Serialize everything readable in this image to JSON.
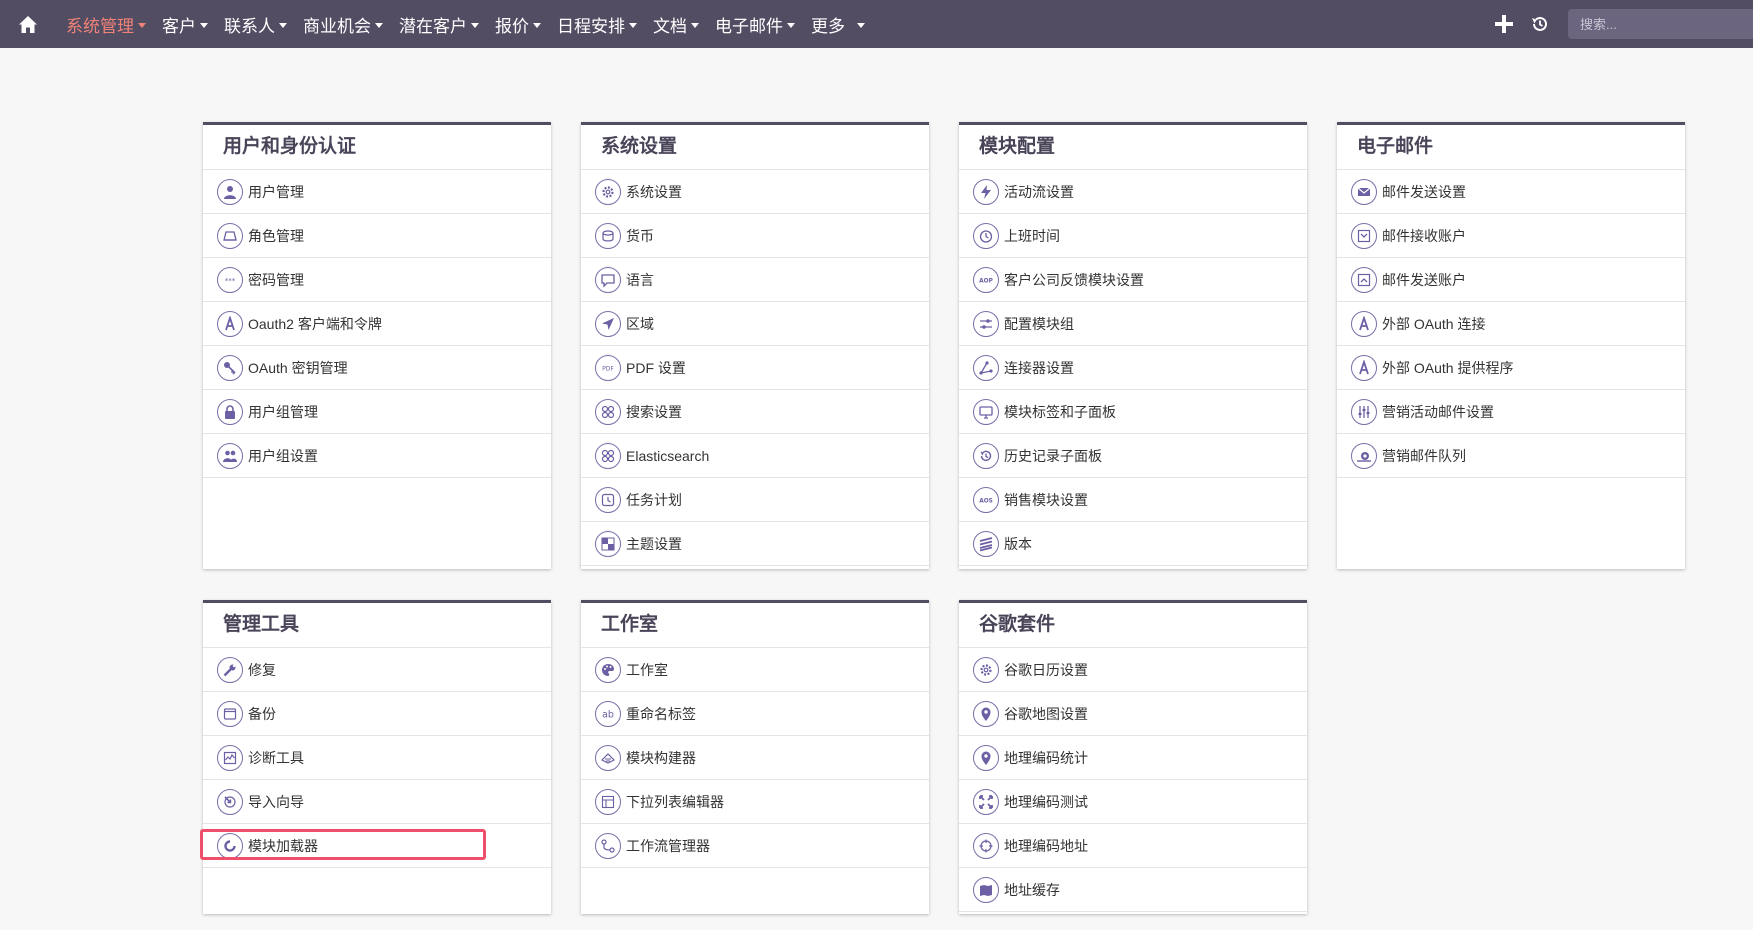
{
  "navbar": {
    "home_icon": "home-icon",
    "items": [
      {
        "label": "系统管理",
        "active": true
      },
      {
        "label": "客户"
      },
      {
        "label": "联系人"
      },
      {
        "label": "商业机会"
      },
      {
        "label": "潜在客户"
      },
      {
        "label": "报价"
      },
      {
        "label": "日程安排"
      },
      {
        "label": "文档"
      },
      {
        "label": "电子邮件"
      },
      {
        "label": "更多"
      }
    ],
    "search_placeholder": "搜索...",
    "active_color": "#f08377",
    "bg_color": "#534d64"
  },
  "panels": [
    {
      "title": "用户和身份认证",
      "items": [
        {
          "label": "用户管理",
          "icon": "user-icon"
        },
        {
          "label": "角色管理",
          "icon": "role-icon"
        },
        {
          "label": "密码管理",
          "icon": "password-icon"
        },
        {
          "label": "Oauth2 客户端和令牌",
          "icon": "oauth-icon"
        },
        {
          "label": "OAuth 密钥管理",
          "icon": "key-icon"
        },
        {
          "label": "用户组管理",
          "icon": "lock-icon"
        },
        {
          "label": "用户组设置",
          "icon": "group-icon"
        }
      ]
    },
    {
      "title": "系统设置",
      "items": [
        {
          "label": "系统设置",
          "icon": "gear-icon"
        },
        {
          "label": "货币",
          "icon": "currency-icon"
        },
        {
          "label": "语言",
          "icon": "speech-icon"
        },
        {
          "label": "区域",
          "icon": "navigation-icon"
        },
        {
          "label": "PDF 设置",
          "icon": "pdf-icon"
        },
        {
          "label": "搜索设置",
          "icon": "search-settings-icon"
        },
        {
          "label": "Elasticsearch",
          "icon": "elasticsearch-icon"
        },
        {
          "label": "任务计划",
          "icon": "scheduler-icon"
        },
        {
          "label": "主题设置",
          "icon": "theme-icon"
        }
      ]
    },
    {
      "title": "模块配置",
      "items": [
        {
          "label": "活动流设置",
          "icon": "lightning-icon"
        },
        {
          "label": "上班时间",
          "icon": "clock-icon"
        },
        {
          "label": "客户公司反馈模块设置",
          "icon": "aop-icon"
        },
        {
          "label": "配置模块组",
          "icon": "sliders-icon"
        },
        {
          "label": "连接器设置",
          "icon": "connector-icon"
        },
        {
          "label": "模块标签和子面板",
          "icon": "monitor-icon"
        },
        {
          "label": "历史记录子面板",
          "icon": "history-icon"
        },
        {
          "label": "销售模块设置",
          "icon": "aos-icon"
        },
        {
          "label": "版本",
          "icon": "layers-icon"
        }
      ]
    },
    {
      "title": "电子邮件",
      "items": [
        {
          "label": "邮件发送设置",
          "icon": "envelope-icon"
        },
        {
          "label": "邮件接收账户",
          "icon": "inbox-icon"
        },
        {
          "label": "邮件发送账户",
          "icon": "outbox-icon"
        },
        {
          "label": "外部 OAuth 连接",
          "icon": "oauth-icon"
        },
        {
          "label": "外部 OAuth 提供程序",
          "icon": "oauth-icon"
        },
        {
          "label": "营销活动邮件设置",
          "icon": "equalizer-icon"
        },
        {
          "label": "营销邮件队列",
          "icon": "snail-icon"
        }
      ]
    },
    {
      "title": "管理工具",
      "items": [
        {
          "label": "修复",
          "icon": "wrench-icon"
        },
        {
          "label": "备份",
          "icon": "backup-icon"
        },
        {
          "label": "诊断工具",
          "icon": "diagnostic-icon"
        },
        {
          "label": "导入向导",
          "icon": "import-icon"
        },
        {
          "label": "模块加载器",
          "icon": "module-loader-icon"
        }
      ]
    },
    {
      "title": "工作室",
      "items": [
        {
          "label": "工作室",
          "icon": "palette-icon"
        },
        {
          "label": "重命名标签",
          "icon": "ab-icon"
        },
        {
          "label": "模块构建器",
          "icon": "builder-icon"
        },
        {
          "label": "下拉列表编辑器",
          "icon": "dropdown-icon"
        },
        {
          "label": "工作流管理器",
          "icon": "workflow-icon"
        }
      ]
    },
    {
      "title": "谷歌套件",
      "items": [
        {
          "label": "谷歌日历设置",
          "icon": "gear-icon"
        },
        {
          "label": "谷歌地图设置",
          "icon": "map-pin-icon"
        },
        {
          "label": "地理编码统计",
          "icon": "map-pin-icon"
        },
        {
          "label": "地理编码测试",
          "icon": "expand-icon"
        },
        {
          "label": "地理编码地址",
          "icon": "crosshair-icon"
        },
        {
          "label": "地址缓存",
          "icon": "cache-icon"
        }
      ]
    }
  ]
}
